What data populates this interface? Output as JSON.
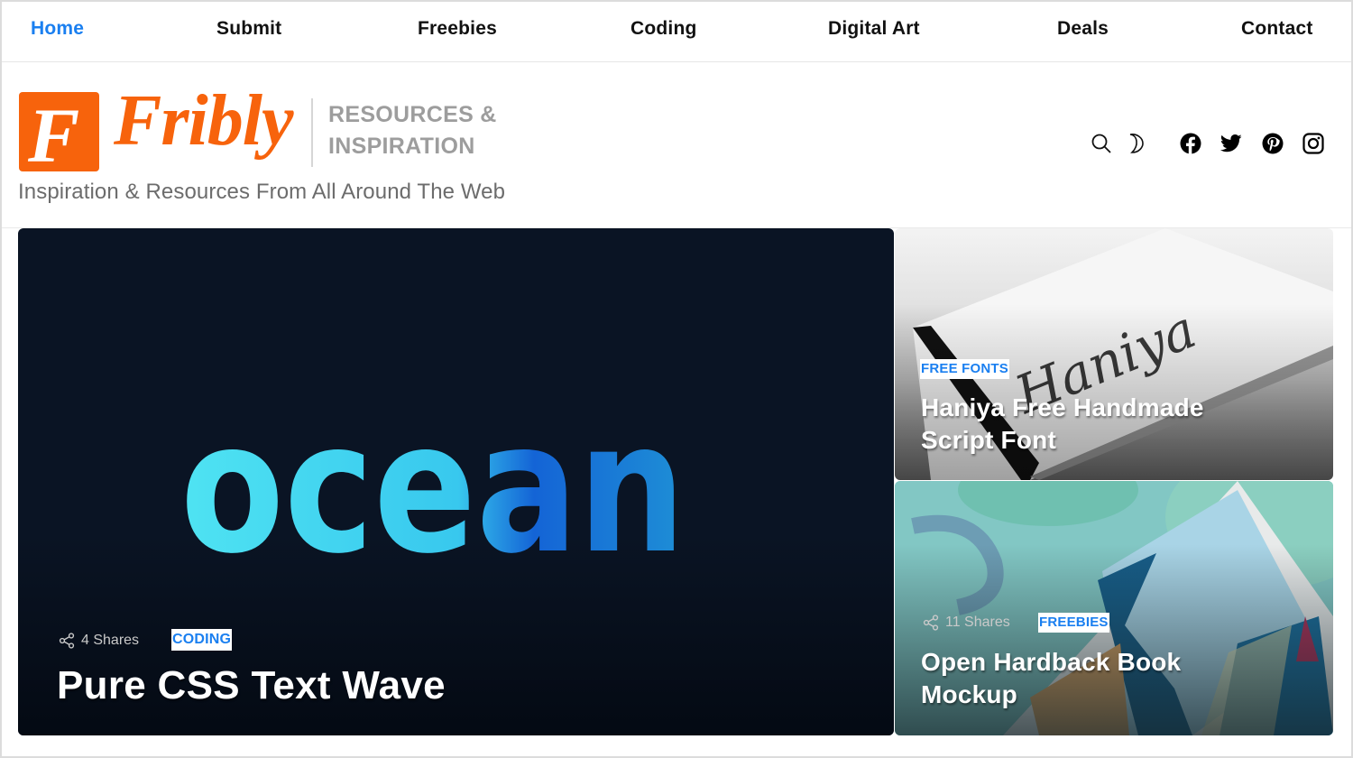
{
  "nav": {
    "items": [
      {
        "label": "Home",
        "active": true
      },
      {
        "label": "Submit",
        "active": false
      },
      {
        "label": "Freebies",
        "active": false
      },
      {
        "label": "Coding",
        "active": false
      },
      {
        "label": "Digital Art",
        "active": false
      },
      {
        "label": "Deals",
        "active": false
      },
      {
        "label": "Contact",
        "active": false
      }
    ]
  },
  "header": {
    "logo_letter": "F",
    "logo_word": "Fribly",
    "logo_tag_line1": "RESOURCES &",
    "logo_tag_line2": "INSPIRATION",
    "tagline": "Inspiration & Resources From All Around The Web",
    "icons": [
      "search-icon",
      "moon-icon",
      "facebook-icon",
      "twitter-icon",
      "pinterest-icon",
      "instagram-icon"
    ],
    "brand_color": "#f7630c",
    "accent_color": "#1a7ff0"
  },
  "posts": [
    {
      "title": "Pure CSS Text Wave",
      "category": "CODING",
      "shares": "4 Shares",
      "image_text": "ocean"
    },
    {
      "title_line1": "Haniya Free Handmade",
      "title_line2": "Script Font",
      "category": "FREE FONTS"
    },
    {
      "title_line1": "Open Hardback Book",
      "title_line2": "Mockup",
      "category": "FREEBIES",
      "shares": "11 Shares"
    }
  ]
}
